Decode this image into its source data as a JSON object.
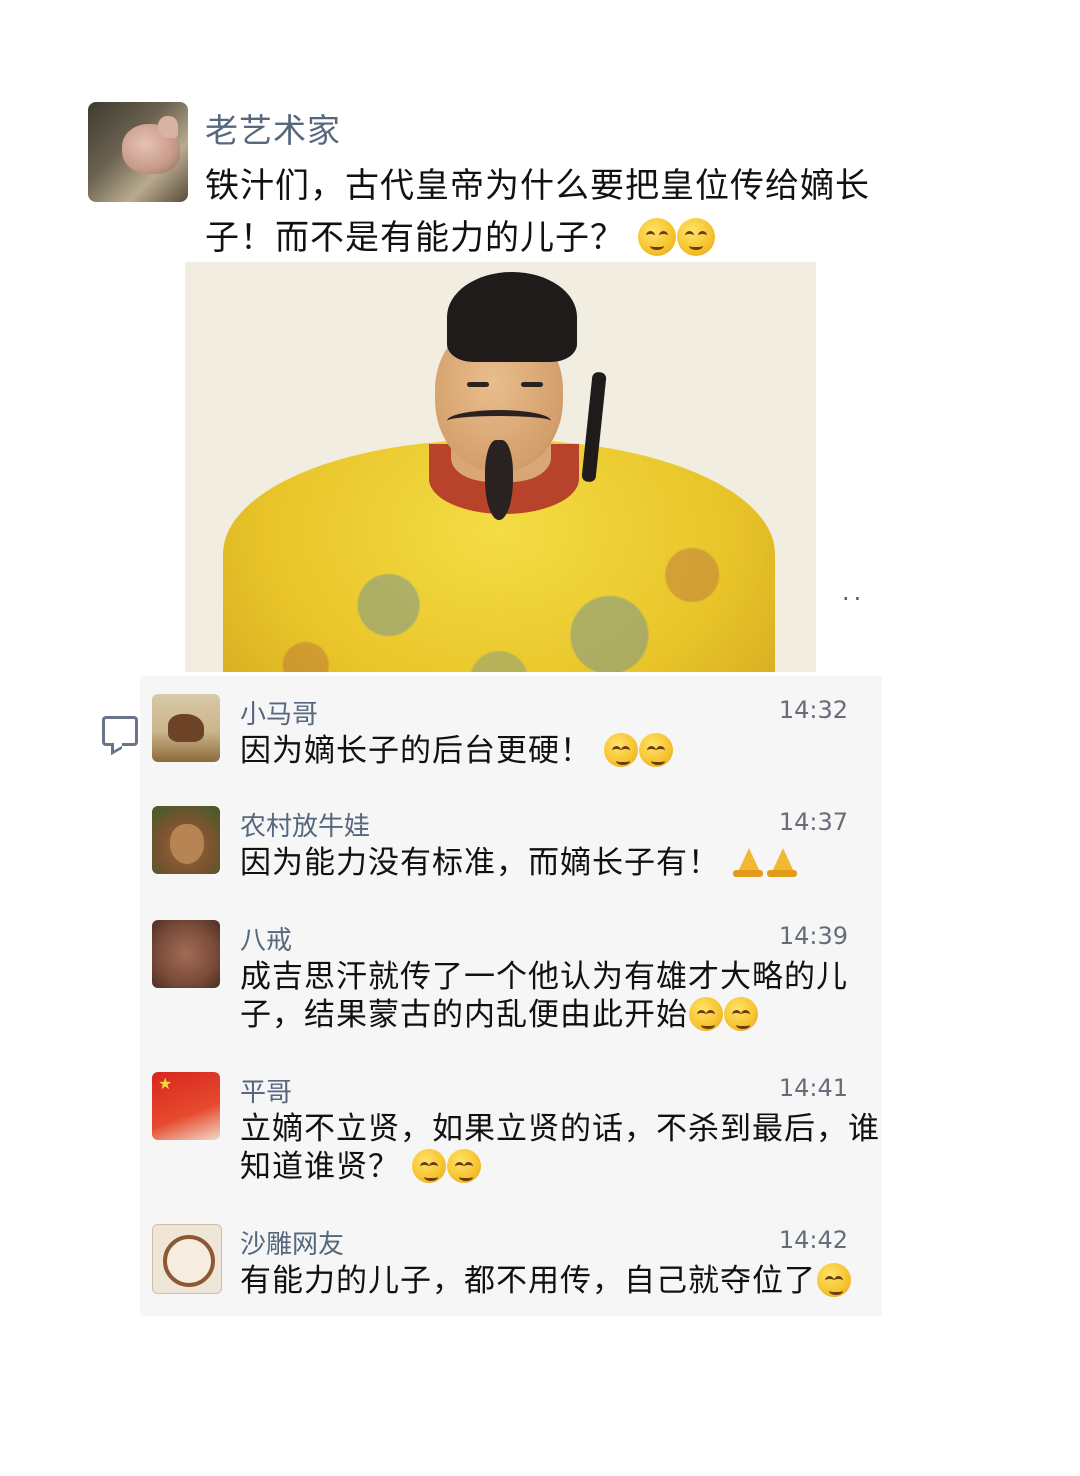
{
  "post": {
    "author": "老艺术家",
    "text": "铁汁们，古代皇帝为什么要把皇位传给嫡长子！而不是有能力的儿子？",
    "emoji_count": 2,
    "image_name": "emperor-portrait",
    "more": "··"
  },
  "comments": [
    {
      "name": "小马哥",
      "time": "14:32",
      "text": "因为嫡长子的后台更硬！",
      "tail": "emoji",
      "tail_count": 2
    },
    {
      "name": "农村放牛娃",
      "time": "14:37",
      "text": "因为能力没有标准，而嫡长子有！",
      "tail": "pray",
      "tail_count": 2
    },
    {
      "name": "八戒",
      "time": "14:39",
      "text": "成吉思汗就传了一个他认为有雄才大略的儿子，结果蒙古的内乱便由此开始",
      "tail": "emoji",
      "tail_count": 2
    },
    {
      "name": "平哥",
      "time": "14:41",
      "text": "立嫡不立贤，如果立贤的话，不杀到最后，谁知道谁贤？",
      "tail": "emoji",
      "tail_count": 2
    },
    {
      "name": "沙雕网友",
      "time": "14:42",
      "text": "有能力的儿子，都不用传，自己就夺位了",
      "tail": "emoji",
      "tail_count": 1
    }
  ]
}
